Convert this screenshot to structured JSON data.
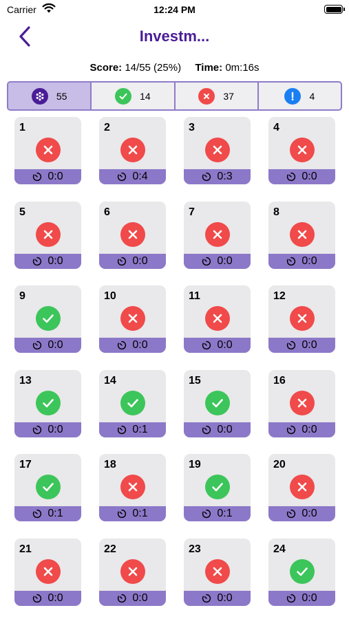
{
  "status_bar": {
    "carrier": "Carrier",
    "time": "12:24 PM"
  },
  "nav": {
    "title": "Investm..."
  },
  "score": {
    "score_label": "Score:",
    "score_value": "14/55 (25%)",
    "time_label": "Time:",
    "time_value": "0m:16s"
  },
  "filters": [
    {
      "key": "all",
      "count": "55",
      "icon": "grid-icon",
      "color": "#4a1d96"
    },
    {
      "key": "correct",
      "count": "14",
      "icon": "check-icon",
      "color": "#3cc55a"
    },
    {
      "key": "wrong",
      "count": "37",
      "icon": "x-icon",
      "color": "#f04a4a"
    },
    {
      "key": "skipped",
      "count": "4",
      "icon": "exclamation-icon",
      "color": "#1a7ff2"
    }
  ],
  "questions": [
    {
      "number": "1",
      "status": "wrong",
      "time": "0:0"
    },
    {
      "number": "2",
      "status": "wrong",
      "time": "0:4"
    },
    {
      "number": "3",
      "status": "wrong",
      "time": "0:3"
    },
    {
      "number": "4",
      "status": "wrong",
      "time": "0:0"
    },
    {
      "number": "5",
      "status": "wrong",
      "time": "0:0"
    },
    {
      "number": "6",
      "status": "wrong",
      "time": "0:0"
    },
    {
      "number": "7",
      "status": "wrong",
      "time": "0:0"
    },
    {
      "number": "8",
      "status": "wrong",
      "time": "0:0"
    },
    {
      "number": "9",
      "status": "right",
      "time": "0:0"
    },
    {
      "number": "10",
      "status": "wrong",
      "time": "0:0"
    },
    {
      "number": "11",
      "status": "wrong",
      "time": "0:0"
    },
    {
      "number": "12",
      "status": "wrong",
      "time": "0:0"
    },
    {
      "number": "13",
      "status": "right",
      "time": "0:0"
    },
    {
      "number": "14",
      "status": "right",
      "time": "0:1"
    },
    {
      "number": "15",
      "status": "right",
      "time": "0:0"
    },
    {
      "number": "16",
      "status": "wrong",
      "time": "0:0"
    },
    {
      "number": "17",
      "status": "right",
      "time": "0:1"
    },
    {
      "number": "18",
      "status": "wrong",
      "time": "0:1"
    },
    {
      "number": "19",
      "status": "right",
      "time": "0:1"
    },
    {
      "number": "20",
      "status": "wrong",
      "time": "0:0"
    },
    {
      "number": "21",
      "status": "wrong",
      "time": "0:0"
    },
    {
      "number": "22",
      "status": "wrong",
      "time": "0:0"
    },
    {
      "number": "23",
      "status": "wrong",
      "time": "0:0"
    },
    {
      "number": "24",
      "status": "right",
      "time": "0:0"
    }
  ],
  "colors": {
    "accent": "#4a1d96",
    "timer_bar": "#8c78c8",
    "correct": "#3cc55a",
    "wrong": "#f04a4a",
    "skipped": "#1a7ff2"
  }
}
